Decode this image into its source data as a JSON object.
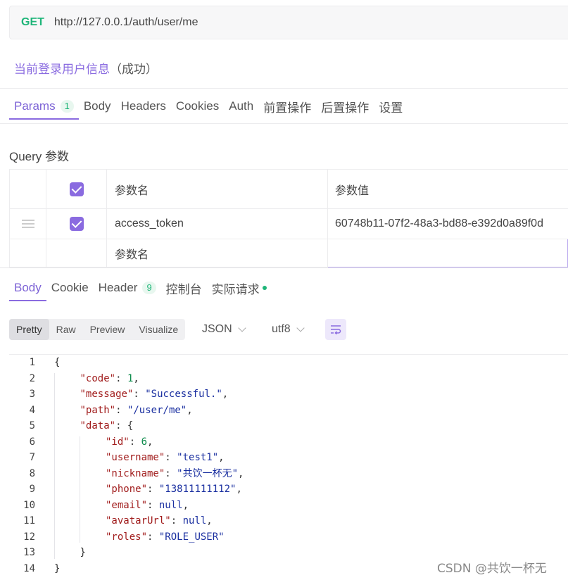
{
  "request": {
    "method": "GET",
    "url": "http://127.0.0.1/auth/user/me"
  },
  "api": {
    "title": "当前登录用户信息",
    "status": "（成功）"
  },
  "request_tabs": [
    {
      "label": "Params",
      "badge": "1",
      "active": true
    },
    {
      "label": "Body"
    },
    {
      "label": "Headers"
    },
    {
      "label": "Cookies"
    },
    {
      "label": "Auth"
    },
    {
      "label": "前置操作"
    },
    {
      "label": "后置操作"
    },
    {
      "label": "设置"
    }
  ],
  "query": {
    "label": "Query 参数",
    "header": {
      "name_placeholder": "参数名",
      "value_placeholder": "参数值"
    },
    "rows": [
      {
        "name": "access_token",
        "value": "60748b11-07f2-48a3-bd88-e392d0a89f0d",
        "enabled": true
      }
    ],
    "new_row": {
      "name_placeholder": "参数名"
    }
  },
  "response_tabs": [
    {
      "label": "Body",
      "active": true
    },
    {
      "label": "Cookie"
    },
    {
      "label": "Header",
      "badge": "9"
    },
    {
      "label": "控制台"
    },
    {
      "label": "实际请求",
      "dot": true
    }
  ],
  "view_modes": [
    "Pretty",
    "Raw",
    "Preview",
    "Visualize"
  ],
  "format": {
    "type": "JSON",
    "encoding": "utf8"
  },
  "code_lines": [
    {
      "n": "1",
      "indent": 0,
      "tokens": [
        [
          "p",
          "{"
        ]
      ]
    },
    {
      "n": "2",
      "indent": 1,
      "tokens": [
        [
          "k",
          "\"code\""
        ],
        [
          "p",
          ": "
        ],
        [
          "n",
          "1"
        ],
        [
          "p",
          ","
        ]
      ]
    },
    {
      "n": "3",
      "indent": 1,
      "tokens": [
        [
          "k",
          "\"message\""
        ],
        [
          "p",
          ": "
        ],
        [
          "s",
          "\"Successful.\""
        ],
        [
          "p",
          ","
        ]
      ]
    },
    {
      "n": "4",
      "indent": 1,
      "tokens": [
        [
          "k",
          "\"path\""
        ],
        [
          "p",
          ": "
        ],
        [
          "s",
          "\"/user/me\""
        ],
        [
          "p",
          ","
        ]
      ]
    },
    {
      "n": "5",
      "indent": 1,
      "tokens": [
        [
          "k",
          "\"data\""
        ],
        [
          "p",
          ": {"
        ]
      ]
    },
    {
      "n": "6",
      "indent": 2,
      "tokens": [
        [
          "k",
          "\"id\""
        ],
        [
          "p",
          ": "
        ],
        [
          "n",
          "6"
        ],
        [
          "p",
          ","
        ]
      ]
    },
    {
      "n": "7",
      "indent": 2,
      "tokens": [
        [
          "k",
          "\"username\""
        ],
        [
          "p",
          ": "
        ],
        [
          "s",
          "\"test1\""
        ],
        [
          "p",
          ","
        ]
      ]
    },
    {
      "n": "8",
      "indent": 2,
      "tokens": [
        [
          "k",
          "\"nickname\""
        ],
        [
          "p",
          ": "
        ],
        [
          "s",
          "\"共饮一杯无\""
        ],
        [
          "p",
          ","
        ]
      ]
    },
    {
      "n": "9",
      "indent": 2,
      "tokens": [
        [
          "k",
          "\"phone\""
        ],
        [
          "p",
          ": "
        ],
        [
          "s",
          "\"13811111112\""
        ],
        [
          "p",
          ","
        ]
      ]
    },
    {
      "n": "10",
      "indent": 2,
      "tokens": [
        [
          "k",
          "\"email\""
        ],
        [
          "p",
          ": "
        ],
        [
          "l",
          "null"
        ],
        [
          "p",
          ","
        ]
      ]
    },
    {
      "n": "11",
      "indent": 2,
      "tokens": [
        [
          "k",
          "\"avatarUrl\""
        ],
        [
          "p",
          ": "
        ],
        [
          "l",
          "null"
        ],
        [
          "p",
          ","
        ]
      ]
    },
    {
      "n": "12",
      "indent": 2,
      "tokens": [
        [
          "k",
          "\"roles\""
        ],
        [
          "p",
          ": "
        ],
        [
          "s",
          "\"ROLE_USER\""
        ]
      ]
    },
    {
      "n": "13",
      "indent": 1,
      "tokens": [
        [
          "p",
          "}"
        ]
      ]
    },
    {
      "n": "14",
      "indent": 0,
      "tokens": [
        [
          "p",
          "}"
        ]
      ]
    }
  ],
  "watermark": "CSDN @共饮一杯无",
  "colors": {
    "accent": "#8a6be0",
    "method_get": "#1fb579",
    "json_key": "#a11d1d",
    "json_string": "#1a2fa0",
    "json_number": "#0b8a4a"
  }
}
